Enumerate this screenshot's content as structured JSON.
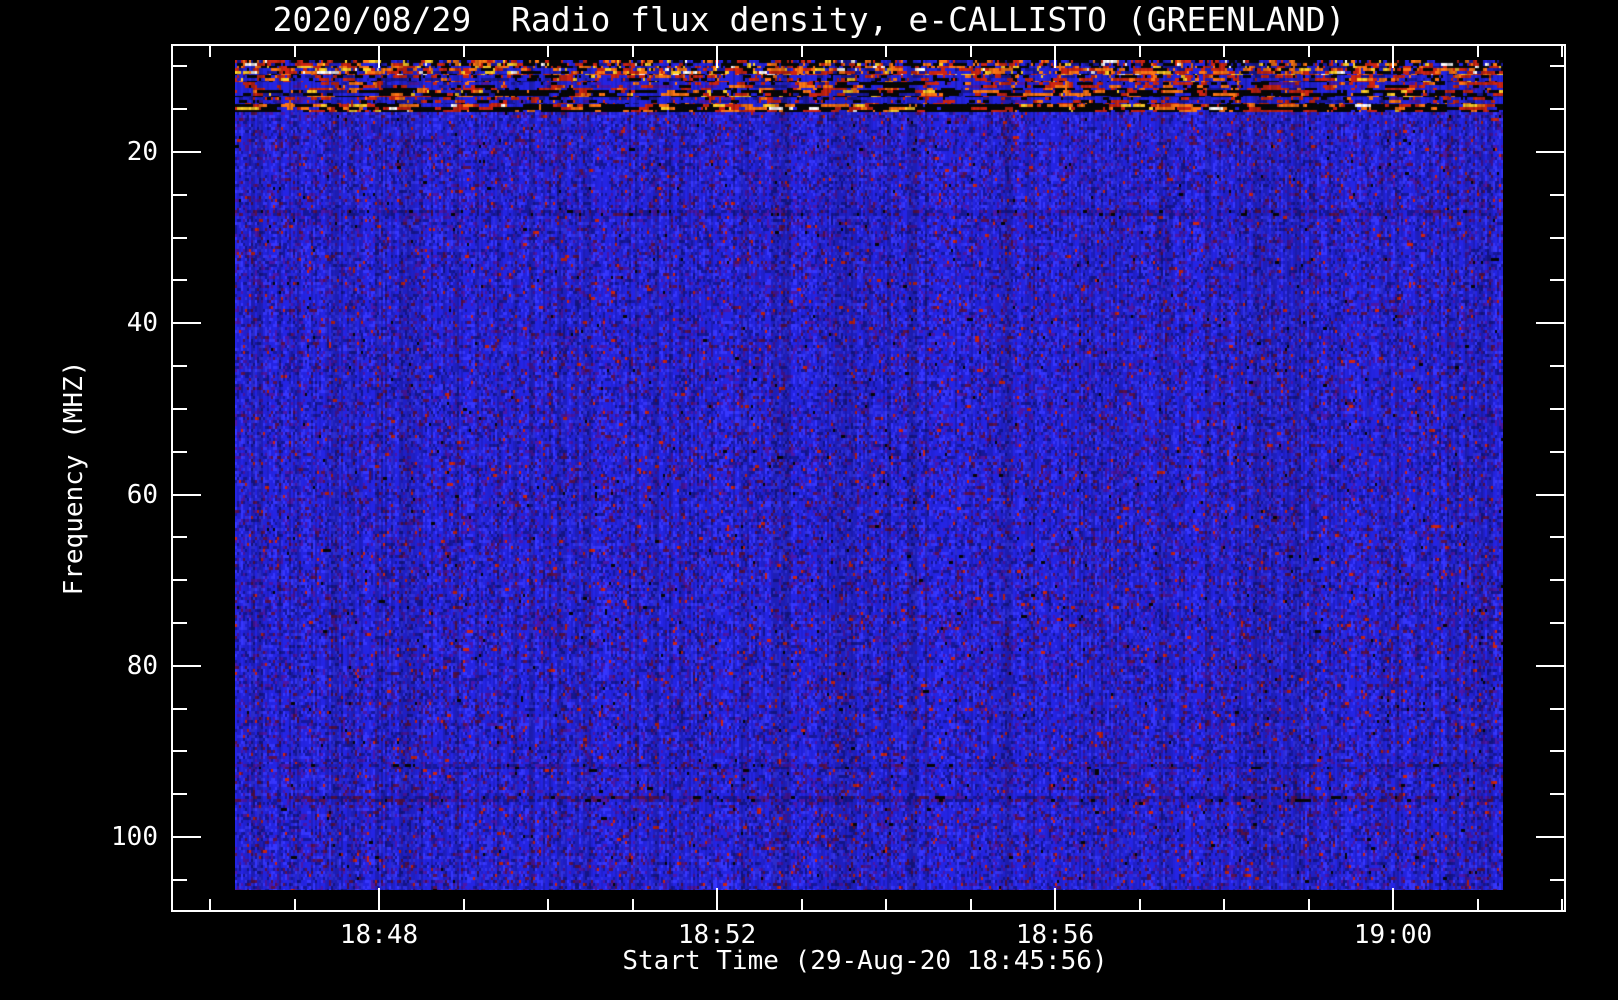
{
  "window": {
    "background": "#000000",
    "foreground": "#ffffff"
  },
  "chart_data": {
    "type": "heatmap",
    "variant": "radio-spectrogram",
    "title": "2020/08/29  Radio flux density, e-CALLISTO (GREENLAND)",
    "xlabel": "Start Time (29-Aug-20 18:45:56)",
    "ylabel": "Frequency (MHZ)",
    "grid": false,
    "legend": "none",
    "colormap_note": "blue = low flux, red/orange/yellow/white = high flux (RFI), black = dropout",
    "x_axis": {
      "major_ticks": [
        {
          "minutes_after_1800": 48,
          "label": "18:48"
        },
        {
          "minutes_after_1800": 52,
          "label": "18:52"
        },
        {
          "minutes_after_1800": 56,
          "label": "18:56"
        },
        {
          "minutes_after_1800": 60,
          "label": "19:00"
        }
      ],
      "minor_tick_minutes": [
        46,
        47,
        49,
        50,
        51,
        53,
        54,
        55,
        57,
        58,
        59,
        61,
        62
      ],
      "major_interval": "4 min",
      "minor_interval": "1 min"
    },
    "y_axis": {
      "major_ticks": [
        {
          "mhz": 20,
          "label": "20"
        },
        {
          "mhz": 40,
          "label": "40"
        },
        {
          "mhz": 60,
          "label": "60"
        },
        {
          "mhz": 80,
          "label": "80"
        },
        {
          "mhz": 100,
          "label": "100"
        }
      ],
      "minor_tick_mhz": [
        10,
        15,
        25,
        30,
        35,
        45,
        50,
        55,
        65,
        70,
        75,
        85,
        90,
        95,
        105
      ],
      "approx_range_mhz": [
        7.5,
        109
      ],
      "direction": "frequency increases downward"
    },
    "features": [
      {
        "freq_mhz": [
          9.5,
          15.5
        ],
        "description": "strong broadband RFI band: speckled red/orange/yellow bursts with long horizontal runs, interleaved black dropout rows"
      },
      {
        "freq_mhz": [
          15.5,
          106
        ],
        "description": "quiet uniform blue background noise with sparse purple/maroon speckles"
      },
      {
        "freq_mhz": 27.2,
        "description": "very faint darker horizontal line"
      },
      {
        "freq_mhz": 91.8,
        "description": "very faint darker horizontal line"
      },
      {
        "freq_mhz": 95.5,
        "description": "faint dark maroon-speckled interference line"
      }
    ],
    "image": {
      "freq_span_mhz": [
        9.2,
        106.3
      ],
      "palette": {
        "black": "#060606",
        "blue": "#2424e4",
        "blue2": "#3636ff",
        "navy": "#17179c",
        "purple": "#4b16aa",
        "maroon": "#5a1150",
        "red": "#cf2412",
        "orange": "#ff7714",
        "yellow": "#ffd028",
        "white": "#ffffff"
      },
      "bands": [
        {
          "f0": 9.2,
          "f1": 10.2,
          "run": 0.45,
          "weights": {
            "black": 34,
            "blue": 22,
            "navy": 12,
            "red": 16,
            "orange": 10,
            "yellow": 4,
            "white": 2
          }
        },
        {
          "f0": 10.2,
          "f1": 11.0,
          "run": 0.55,
          "weights": {
            "blue": 26,
            "red": 27,
            "orange": 17,
            "black": 12,
            "navy": 6,
            "yellow": 8,
            "white": 4
          }
        },
        {
          "f0": 11.0,
          "f1": 11.8,
          "run": 0.5,
          "weights": {
            "blue": 42,
            "navy": 12,
            "red": 21,
            "black": 14,
            "orange": 9,
            "yellow": 2
          }
        },
        {
          "f0": 11.8,
          "f1": 12.75,
          "run": 0.65,
          "weights": {
            "blue": 44,
            "red": 22,
            "black": 13,
            "purple": 8,
            "orange": 9,
            "navy": 4
          }
        },
        {
          "f0": 12.75,
          "f1": 13.6,
          "run": 0.7,
          "weights": {
            "black": 48,
            "navy": 10,
            "blue": 13,
            "red": 15,
            "orange": 9,
            "yellow": 5
          }
        },
        {
          "f0": 13.6,
          "f1": 14.4,
          "run": 0.5,
          "weights": {
            "blue": 50,
            "navy": 15,
            "red": 15,
            "black": 11,
            "purple": 6,
            "orange": 3
          }
        },
        {
          "f0": 14.4,
          "f1": 15.3,
          "run": 0.72,
          "weights": {
            "black": 52,
            "red": 17,
            "orange": 15,
            "blue": 9,
            "yellow": 5,
            "white": 2
          }
        },
        {
          "f0": 15.3,
          "f1": 26.8,
          "run": 0.12,
          "weights": {
            "blue": 48,
            "blue2": 21,
            "navy": 13,
            "purple": 11,
            "maroon": 5,
            "red": 1.5,
            "black": 0.5
          }
        },
        {
          "f0": 26.8,
          "f1": 27.5,
          "run": 0.3,
          "weights": {
            "blue": 38,
            "navy": 30,
            "purple": 18,
            "maroon": 10,
            "black": 4
          }
        },
        {
          "f0": 27.5,
          "f1": 91.5,
          "run": 0.12,
          "weights": {
            "blue": 48,
            "blue2": 21,
            "navy": 13,
            "purple": 11,
            "maroon": 5,
            "red": 1.5,
            "black": 0.5
          }
        },
        {
          "f0": 91.5,
          "f1": 92.1,
          "run": 0.3,
          "weights": {
            "blue": 45,
            "navy": 28,
            "purple": 16,
            "maroon": 8,
            "black": 3
          }
        },
        {
          "f0": 92.1,
          "f1": 95.2,
          "run": 0.12,
          "weights": {
            "blue": 48,
            "blue2": 21,
            "navy": 13,
            "purple": 11,
            "maroon": 5,
            "red": 1.5,
            "black": 0.5
          }
        },
        {
          "f0": 95.2,
          "f1": 95.9,
          "run": 0.35,
          "weights": {
            "blue": 30,
            "navy": 30,
            "purple": 20,
            "maroon": 16,
            "black": 4
          }
        },
        {
          "f0": 95.9,
          "f1": 106.3,
          "run": 0.12,
          "weights": {
            "blue": 48,
            "blue2": 21,
            "navy": 13,
            "purple": 11,
            "maroon": 5,
            "red": 1.5,
            "black": 0.5
          }
        }
      ]
    }
  }
}
